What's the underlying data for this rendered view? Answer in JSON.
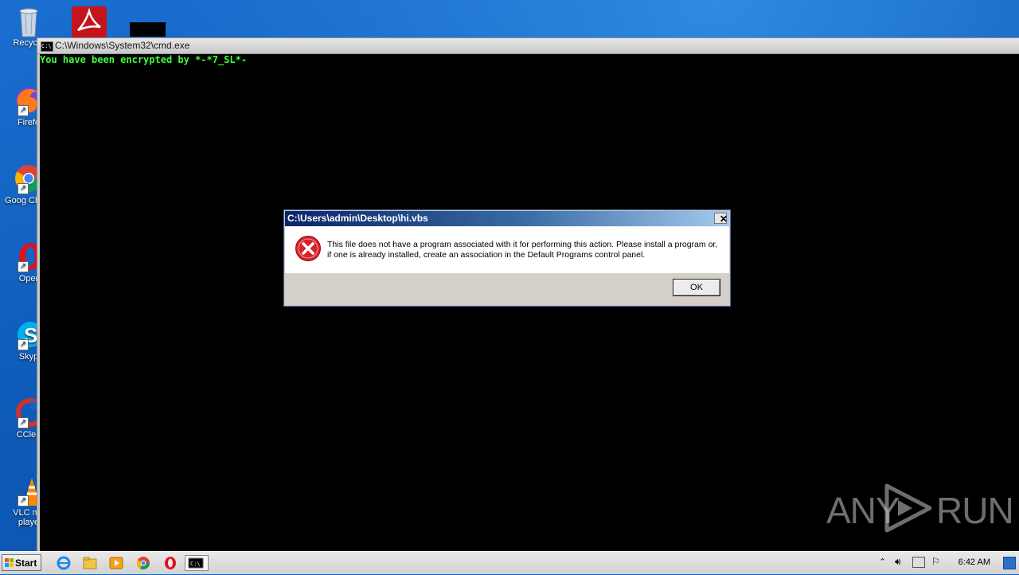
{
  "desktop": {
    "icons": [
      {
        "label": "Recycle",
        "icon": "recycle-bin-icon"
      },
      {
        "label": "Firefo",
        "icon": "firefox-icon"
      },
      {
        "label": "Goog Chron",
        "icon": "chrome-icon"
      },
      {
        "label": "Oper",
        "icon": "opera-icon"
      },
      {
        "label": "Skyp",
        "icon": "skype-icon"
      },
      {
        "label": "CClea",
        "icon": "ccleaner-icon"
      },
      {
        "label": "VLC me playe",
        "icon": "vlc-icon"
      }
    ]
  },
  "cmd_window": {
    "title": "C:\\Windows\\System32\\cmd.exe",
    "output_line": "You have been encrypted by *-*7_SL*-"
  },
  "dialog": {
    "title": "C:\\Users\\admin\\Desktop\\hi.vbs",
    "message": "This file does not have a program associated with it for performing this action. Please install a program or, if one is already installed, create an association in the Default Programs control panel.",
    "ok_label": "OK",
    "close_label": "✕"
  },
  "taskbar": {
    "start_label": "Start",
    "clock": "6:42 AM",
    "pinned": [
      "ie-icon",
      "explorer-icon",
      "media-player-icon",
      "chrome-icon",
      "opera-icon",
      "cmd-icon"
    ]
  },
  "watermark": {
    "text_left": "ANY",
    "text_right": "RUN"
  },
  "colors": {
    "console_text": "#3cff3c",
    "dialog_title_start": "#0a246a",
    "desktop_blue": "#1565c0"
  }
}
